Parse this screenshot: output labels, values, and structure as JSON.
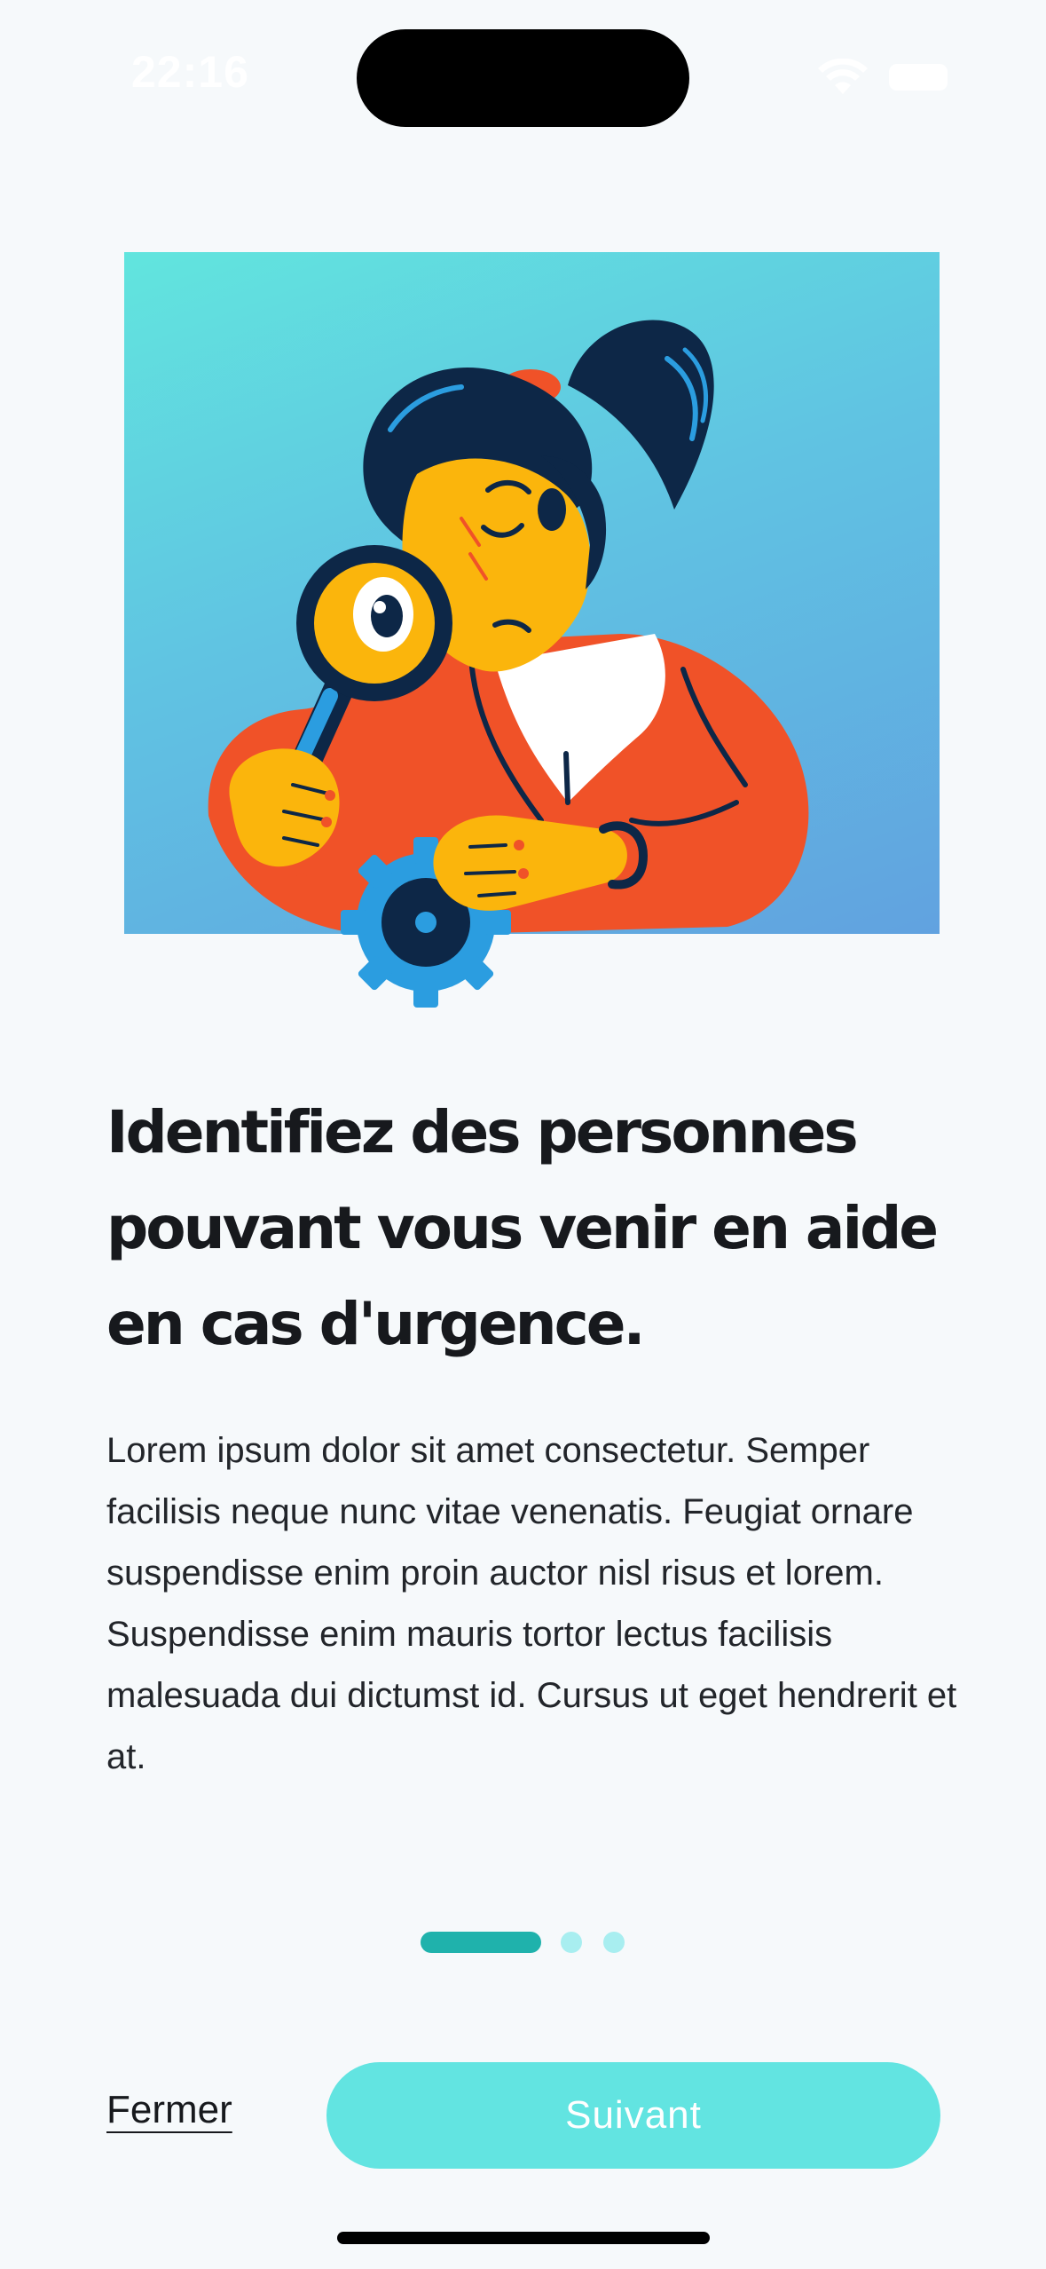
{
  "status_bar": {
    "time": "22:16",
    "wifi_icon": "wifi-icon",
    "battery_icon": "battery-icon"
  },
  "hero": {
    "illustration": "woman-with-magnifying-glass-and-gear",
    "colors": {
      "gradient_start": "#61e5de",
      "gradient_end": "#61a2e0",
      "hair": "#0d2747",
      "skin": "#fbb50c",
      "sweater": "#f05228",
      "gear": "#2b9de0"
    }
  },
  "onboarding": {
    "title": "Identifiez des personnes pouvant vous venir en aide en cas d'urgence.",
    "body": "Lorem ipsum dolor sit amet consectetur. Semper facilisis neque nunc vitae venenatis. Feugiat ornare suspendisse enim proin auctor nisl risus et lorem. Suspendisse enim mauris tortor lectus facilisis malesuada dui dictumst id. Cursus ut eget hendrerit et at."
  },
  "pager": {
    "total_pages": 3,
    "current_page": 1,
    "active_color": "#1fb2ac",
    "inactive_color": "#a8eef0"
  },
  "footer": {
    "close_label": "Fermer",
    "next_label": "Suivant",
    "button_color": "#62e4e1"
  }
}
